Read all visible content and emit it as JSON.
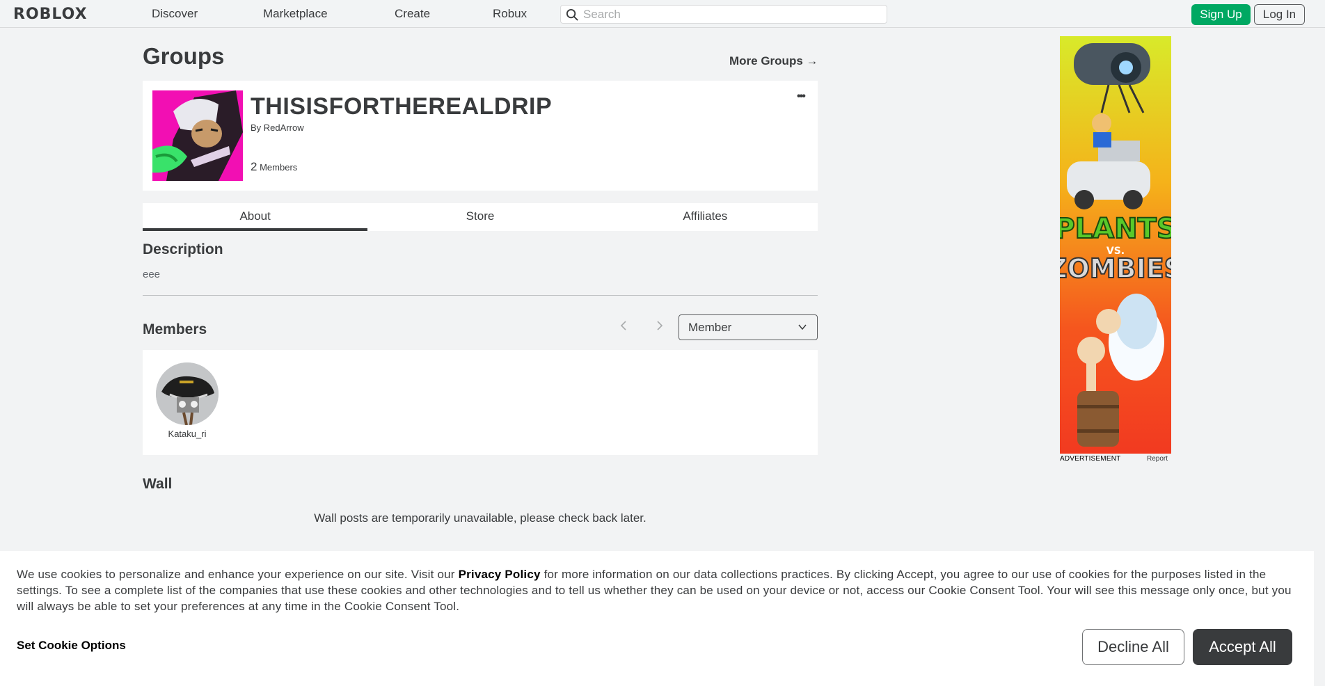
{
  "header": {
    "logo": "ROBLOX",
    "nav": [
      "Discover",
      "Marketplace",
      "Create",
      "Robux"
    ],
    "search_placeholder": "Search",
    "signup_label": "Sign Up",
    "login_label": "Log In"
  },
  "page": {
    "title": "Groups",
    "more_groups": "More Groups →"
  },
  "group": {
    "name": "THISISFORTHEREALDRIP",
    "by_prefix": "By",
    "owner": "RedArrow",
    "member_count": "2",
    "member_label": "Members",
    "menu_icon": "more-dots-icon"
  },
  "tabs": [
    "About",
    "Store",
    "Affiliates"
  ],
  "about": {
    "description_heading": "Description",
    "description": "eee",
    "members_heading": "Members",
    "role_selected": "Member",
    "members": [
      {
        "name": "Kataku_ri"
      }
    ],
    "wall_heading": "Wall",
    "wall_message": "Wall posts are temporarily unavailable, please check back later."
  },
  "ad": {
    "label": "ADVERTISEMENT",
    "report": "Report",
    "title_line1": "PLANTS",
    "title_vs": "VS.",
    "title_line2": "ZOMBIES"
  },
  "cookie": {
    "text_before": "We use cookies to personalize and enhance your experience on our site. Visit our ",
    "link": "Privacy Policy",
    "text_after": " for more information on our data collections practices. By clicking Accept, you agree to our use of cookies for the purposes listed in the settings. To see a complete list of the companies that use these cookies and other technologies and to tell us whether they can be used on your device or not, access our Cookie Consent Tool. Your will see this message only once, but you will always be able to set your preferences at any time in the Cookie Consent Tool.",
    "options_label": "Set Cookie Options",
    "decline_label": "Decline All",
    "accept_label": "Accept All"
  },
  "colors": {
    "signup": "#00a862",
    "accept": "#393b3d",
    "background": "#f2f3f4"
  }
}
